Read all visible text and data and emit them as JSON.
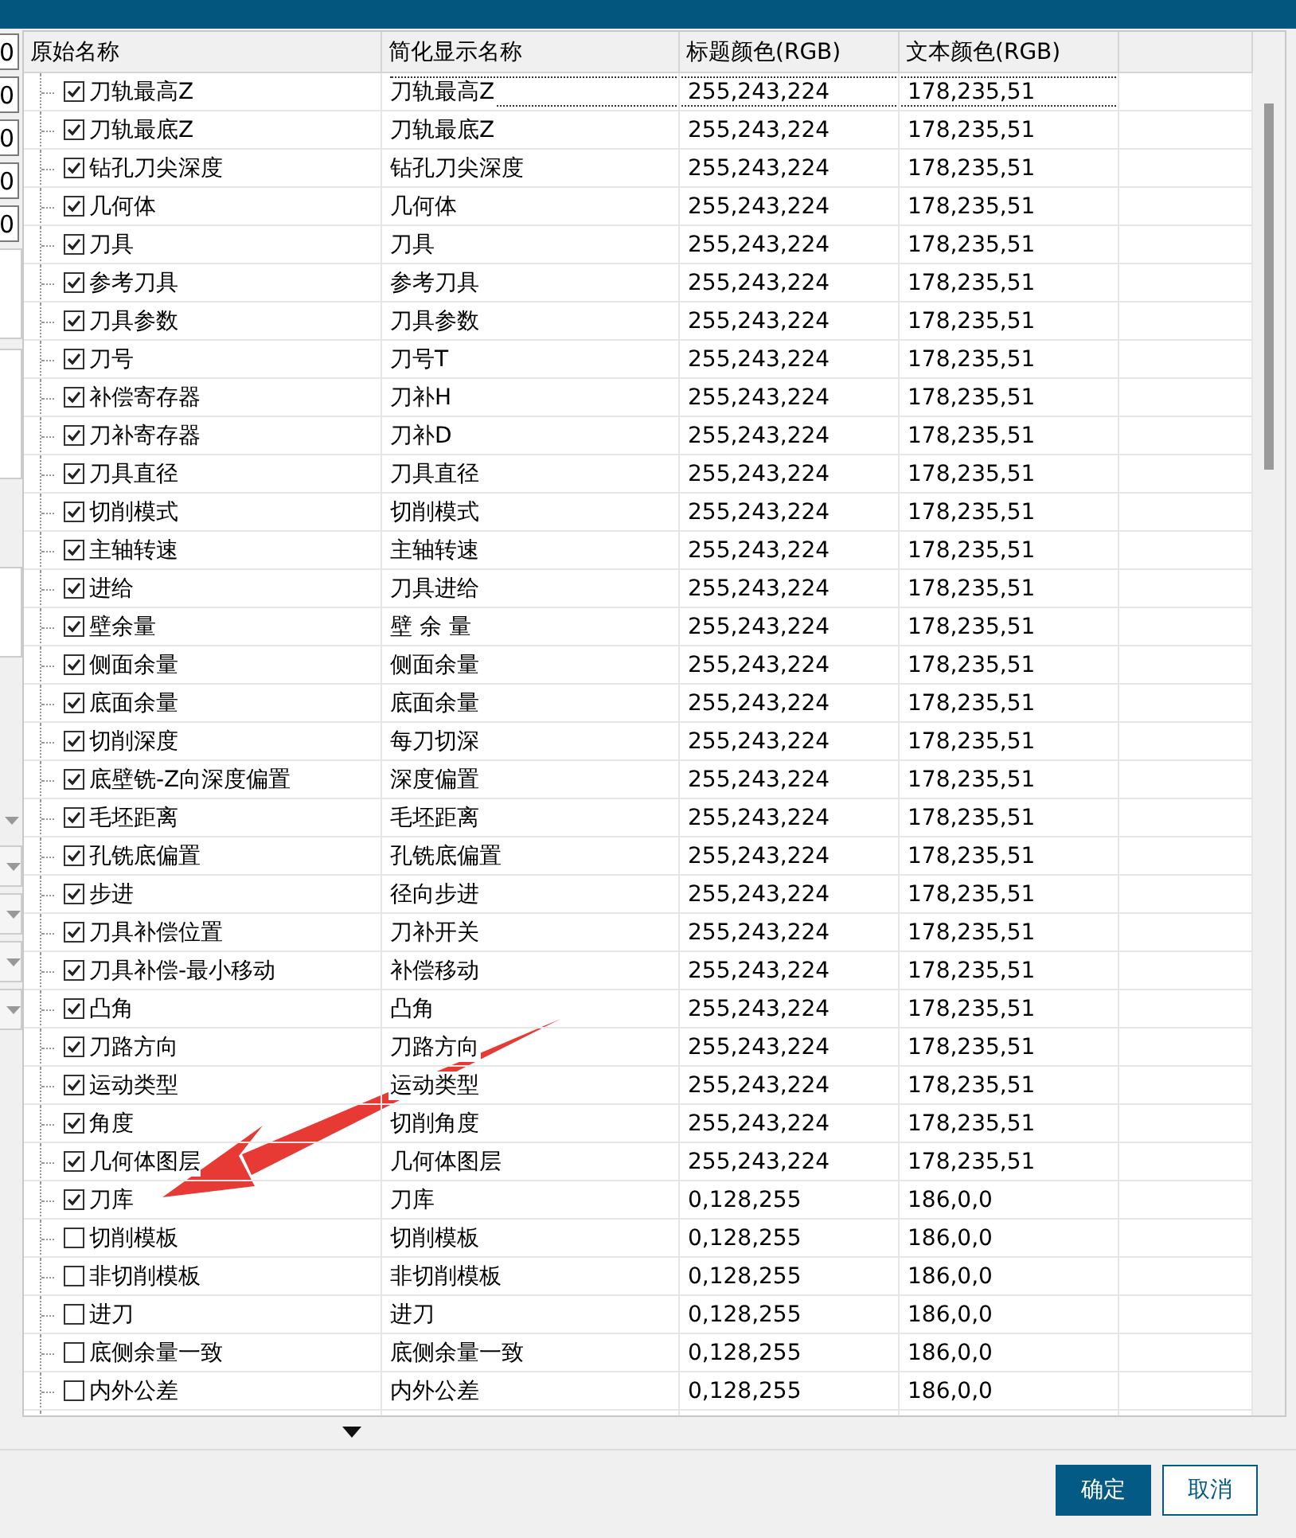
{
  "left_panel": {
    "fields": [
      {
        "value": "0"
      },
      {
        "value": "0"
      },
      {
        "value": "0"
      },
      {
        "value": "0"
      },
      {
        "value": "0"
      }
    ]
  },
  "table": {
    "columns": [
      "原始名称",
      "简化显示名称",
      "标题颜色(RGB)",
      "文本颜色(RGB)"
    ],
    "rows": [
      {
        "original": "刀轨最高Z",
        "display": "刀轨最高Z",
        "title_color": "255,243,224",
        "text_color": "178,235,51",
        "checked": true,
        "focused": true
      },
      {
        "original": "刀轨最底Z",
        "display": "刀轨最底Z",
        "title_color": "255,243,224",
        "text_color": "178,235,51",
        "checked": true,
        "focused": false
      },
      {
        "original": "钻孔刀尖深度",
        "display": "钻孔刀尖深度",
        "title_color": "255,243,224",
        "text_color": "178,235,51",
        "checked": true,
        "focused": false
      },
      {
        "original": "几何体",
        "display": "几何体",
        "title_color": "255,243,224",
        "text_color": "178,235,51",
        "checked": true,
        "focused": false
      },
      {
        "original": "刀具",
        "display": "刀具",
        "title_color": "255,243,224",
        "text_color": "178,235,51",
        "checked": true,
        "focused": false
      },
      {
        "original": "参考刀具",
        "display": "参考刀具",
        "title_color": "255,243,224",
        "text_color": "178,235,51",
        "checked": true,
        "focused": false
      },
      {
        "original": "刀具参数",
        "display": "刀具参数",
        "title_color": "255,243,224",
        "text_color": "178,235,51",
        "checked": true,
        "focused": false
      },
      {
        "original": "刀号",
        "display": "刀号T",
        "title_color": "255,243,224",
        "text_color": "178,235,51",
        "checked": true,
        "focused": false
      },
      {
        "original": "补偿寄存器",
        "display": "刀补H",
        "title_color": "255,243,224",
        "text_color": "178,235,51",
        "checked": true,
        "focused": false
      },
      {
        "original": "刀补寄存器",
        "display": "刀补D",
        "title_color": "255,243,224",
        "text_color": "178,235,51",
        "checked": true,
        "focused": false
      },
      {
        "original": "刀具直径",
        "display": "刀具直径",
        "title_color": "255,243,224",
        "text_color": "178,235,51",
        "checked": true,
        "focused": false
      },
      {
        "original": "切削模式",
        "display": "切削模式",
        "title_color": "255,243,224",
        "text_color": "178,235,51",
        "checked": true,
        "focused": false
      },
      {
        "original": "主轴转速",
        "display": "主轴转速",
        "title_color": "255,243,224",
        "text_color": "178,235,51",
        "checked": true,
        "focused": false
      },
      {
        "original": "进给",
        "display": "刀具进给",
        "title_color": "255,243,224",
        "text_color": "178,235,51",
        "checked": true,
        "focused": false
      },
      {
        "original": "壁余量",
        "display": "壁 余 量",
        "title_color": "255,243,224",
        "text_color": "178,235,51",
        "checked": true,
        "focused": false
      },
      {
        "original": "侧面余量",
        "display": "侧面余量",
        "title_color": "255,243,224",
        "text_color": "178,235,51",
        "checked": true,
        "focused": false
      },
      {
        "original": "底面余量",
        "display": "底面余量",
        "title_color": "255,243,224",
        "text_color": "178,235,51",
        "checked": true,
        "focused": false
      },
      {
        "original": "切削深度",
        "display": "每刀切深",
        "title_color": "255,243,224",
        "text_color": "178,235,51",
        "checked": true,
        "focused": false
      },
      {
        "original": "底壁铣-Z向深度偏置",
        "display": "深度偏置",
        "title_color": "255,243,224",
        "text_color": "178,235,51",
        "checked": true,
        "focused": false
      },
      {
        "original": "毛坯距离",
        "display": "毛坯距离",
        "title_color": "255,243,224",
        "text_color": "178,235,51",
        "checked": true,
        "focused": false
      },
      {
        "original": "孔铣底偏置",
        "display": "孔铣底偏置",
        "title_color": "255,243,224",
        "text_color": "178,235,51",
        "checked": true,
        "focused": false
      },
      {
        "original": "步进",
        "display": "径向步进",
        "title_color": "255,243,224",
        "text_color": "178,235,51",
        "checked": true,
        "focused": false
      },
      {
        "original": "刀具补偿位置",
        "display": "刀补开关",
        "title_color": "255,243,224",
        "text_color": "178,235,51",
        "checked": true,
        "focused": false
      },
      {
        "original": "刀具补偿-最小移动",
        "display": "补偿移动",
        "title_color": "255,243,224",
        "text_color": "178,235,51",
        "checked": true,
        "focused": false
      },
      {
        "original": "凸角",
        "display": "凸角",
        "title_color": "255,243,224",
        "text_color": "178,235,51",
        "checked": true,
        "focused": false
      },
      {
        "original": "刀路方向",
        "display": "刀路方向",
        "title_color": "255,243,224",
        "text_color": "178,235,51",
        "checked": true,
        "focused": false
      },
      {
        "original": "运动类型",
        "display": "运动类型",
        "title_color": "255,243,224",
        "text_color": "178,235,51",
        "checked": true,
        "focused": false
      },
      {
        "original": "角度",
        "display": "切削角度",
        "title_color": "255,243,224",
        "text_color": "178,235,51",
        "checked": true,
        "focused": false
      },
      {
        "original": "几何体图层",
        "display": "几何体图层",
        "title_color": "255,243,224",
        "text_color": "178,235,51",
        "checked": true,
        "focused": false
      },
      {
        "original": "刀库",
        "display": "刀库",
        "title_color": "0,128,255",
        "text_color": "186,0,0",
        "checked": true,
        "focused": false
      },
      {
        "original": "切削模板",
        "display": "切削模板",
        "title_color": "0,128,255",
        "text_color": "186,0,0",
        "checked": false,
        "focused": false
      },
      {
        "original": "非切削模板",
        "display": "非切削模板",
        "title_color": "0,128,255",
        "text_color": "186,0,0",
        "checked": false,
        "focused": false
      },
      {
        "original": "进刀",
        "display": "进刀",
        "title_color": "0,128,255",
        "text_color": "186,0,0",
        "checked": false,
        "focused": false
      },
      {
        "original": "底侧余量一致",
        "display": "底侧余量一致",
        "title_color": "0,128,255",
        "text_color": "186,0,0",
        "checked": false,
        "focused": false
      },
      {
        "original": "内外公差",
        "display": "内外公差",
        "title_color": "0,128,255",
        "text_color": "186,0,0",
        "checked": false,
        "focused": false
      }
    ]
  },
  "buttons": [
    {
      "label": "确定",
      "kind": "primary"
    },
    {
      "label": "取消",
      "kind": "secondary"
    }
  ]
}
